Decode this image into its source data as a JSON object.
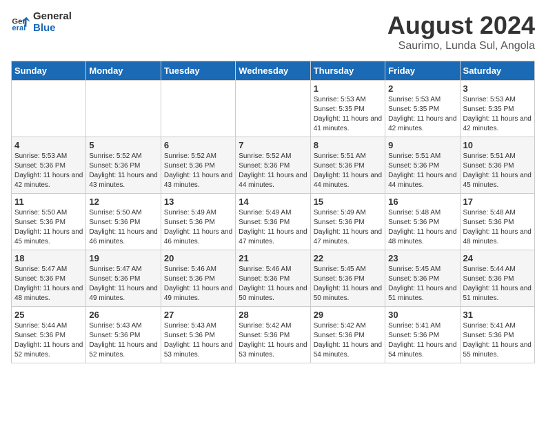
{
  "logo": {
    "line1": "General",
    "line2": "Blue"
  },
  "title": "August 2024",
  "subtitle": "Saurimo, Lunda Sul, Angola",
  "days_of_week": [
    "Sunday",
    "Monday",
    "Tuesday",
    "Wednesday",
    "Thursday",
    "Friday",
    "Saturday"
  ],
  "weeks": [
    [
      {
        "day": "",
        "info": ""
      },
      {
        "day": "",
        "info": ""
      },
      {
        "day": "",
        "info": ""
      },
      {
        "day": "",
        "info": ""
      },
      {
        "day": "1",
        "info": "Sunrise: 5:53 AM\nSunset: 5:35 PM\nDaylight: 11 hours\nand 41 minutes."
      },
      {
        "day": "2",
        "info": "Sunrise: 5:53 AM\nSunset: 5:35 PM\nDaylight: 11 hours\nand 42 minutes."
      },
      {
        "day": "3",
        "info": "Sunrise: 5:53 AM\nSunset: 5:35 PM\nDaylight: 11 hours\nand 42 minutes."
      }
    ],
    [
      {
        "day": "4",
        "info": "Sunrise: 5:53 AM\nSunset: 5:36 PM\nDaylight: 11 hours\nand 42 minutes."
      },
      {
        "day": "5",
        "info": "Sunrise: 5:52 AM\nSunset: 5:36 PM\nDaylight: 11 hours\nand 43 minutes."
      },
      {
        "day": "6",
        "info": "Sunrise: 5:52 AM\nSunset: 5:36 PM\nDaylight: 11 hours\nand 43 minutes."
      },
      {
        "day": "7",
        "info": "Sunrise: 5:52 AM\nSunset: 5:36 PM\nDaylight: 11 hours\nand 44 minutes."
      },
      {
        "day": "8",
        "info": "Sunrise: 5:51 AM\nSunset: 5:36 PM\nDaylight: 11 hours\nand 44 minutes."
      },
      {
        "day": "9",
        "info": "Sunrise: 5:51 AM\nSunset: 5:36 PM\nDaylight: 11 hours\nand 44 minutes."
      },
      {
        "day": "10",
        "info": "Sunrise: 5:51 AM\nSunset: 5:36 PM\nDaylight: 11 hours\nand 45 minutes."
      }
    ],
    [
      {
        "day": "11",
        "info": "Sunrise: 5:50 AM\nSunset: 5:36 PM\nDaylight: 11 hours\nand 45 minutes."
      },
      {
        "day": "12",
        "info": "Sunrise: 5:50 AM\nSunset: 5:36 PM\nDaylight: 11 hours\nand 46 minutes."
      },
      {
        "day": "13",
        "info": "Sunrise: 5:49 AM\nSunset: 5:36 PM\nDaylight: 11 hours\nand 46 minutes."
      },
      {
        "day": "14",
        "info": "Sunrise: 5:49 AM\nSunset: 5:36 PM\nDaylight: 11 hours\nand 47 minutes."
      },
      {
        "day": "15",
        "info": "Sunrise: 5:49 AM\nSunset: 5:36 PM\nDaylight: 11 hours\nand 47 minutes."
      },
      {
        "day": "16",
        "info": "Sunrise: 5:48 AM\nSunset: 5:36 PM\nDaylight: 11 hours\nand 48 minutes."
      },
      {
        "day": "17",
        "info": "Sunrise: 5:48 AM\nSunset: 5:36 PM\nDaylight: 11 hours\nand 48 minutes."
      }
    ],
    [
      {
        "day": "18",
        "info": "Sunrise: 5:47 AM\nSunset: 5:36 PM\nDaylight: 11 hours\nand 48 minutes."
      },
      {
        "day": "19",
        "info": "Sunrise: 5:47 AM\nSunset: 5:36 PM\nDaylight: 11 hours\nand 49 minutes."
      },
      {
        "day": "20",
        "info": "Sunrise: 5:46 AM\nSunset: 5:36 PM\nDaylight: 11 hours\nand 49 minutes."
      },
      {
        "day": "21",
        "info": "Sunrise: 5:46 AM\nSunset: 5:36 PM\nDaylight: 11 hours\nand 50 minutes."
      },
      {
        "day": "22",
        "info": "Sunrise: 5:45 AM\nSunset: 5:36 PM\nDaylight: 11 hours\nand 50 minutes."
      },
      {
        "day": "23",
        "info": "Sunrise: 5:45 AM\nSunset: 5:36 PM\nDaylight: 11 hours\nand 51 minutes."
      },
      {
        "day": "24",
        "info": "Sunrise: 5:44 AM\nSunset: 5:36 PM\nDaylight: 11 hours\nand 51 minutes."
      }
    ],
    [
      {
        "day": "25",
        "info": "Sunrise: 5:44 AM\nSunset: 5:36 PM\nDaylight: 11 hours\nand 52 minutes."
      },
      {
        "day": "26",
        "info": "Sunrise: 5:43 AM\nSunset: 5:36 PM\nDaylight: 11 hours\nand 52 minutes."
      },
      {
        "day": "27",
        "info": "Sunrise: 5:43 AM\nSunset: 5:36 PM\nDaylight: 11 hours\nand 53 minutes."
      },
      {
        "day": "28",
        "info": "Sunrise: 5:42 AM\nSunset: 5:36 PM\nDaylight: 11 hours\nand 53 minutes."
      },
      {
        "day": "29",
        "info": "Sunrise: 5:42 AM\nSunset: 5:36 PM\nDaylight: 11 hours\nand 54 minutes."
      },
      {
        "day": "30",
        "info": "Sunrise: 5:41 AM\nSunset: 5:36 PM\nDaylight: 11 hours\nand 54 minutes."
      },
      {
        "day": "31",
        "info": "Sunrise: 5:41 AM\nSunset: 5:36 PM\nDaylight: 11 hours\nand 55 minutes."
      }
    ]
  ]
}
